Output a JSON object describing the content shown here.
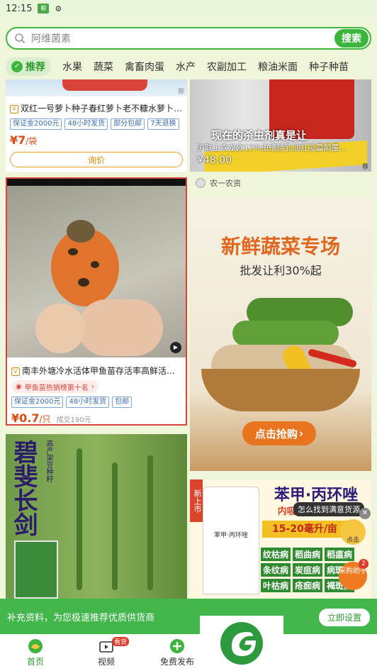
{
  "status": {
    "time": "12:15"
  },
  "search": {
    "placeholder": "阿维菌素",
    "button": "搜索"
  },
  "categories": {
    "active": "推荐",
    "items": [
      "水果",
      "蔬菜",
      "禽畜肉蛋",
      "水产",
      "农副加工",
      "粮油米面",
      "种子种苗"
    ]
  },
  "card1": {
    "title": "双红一号萝卜种子春红萝卜老不糠水萝卜种子",
    "tags": [
      "保证金2000元",
      "48小时发货",
      "部分包邮",
      "7天退换"
    ],
    "price": "¥7",
    "unit": "/袋",
    "inquire": "询价",
    "ad_corner": "荐"
  },
  "card2": {
    "overlay_title": "现在的杀虫剂真是让",
    "overlay_sub": "沪联上农龙欧12%虫螨腈乳油虹吸震颠覆...",
    "price": "¥48.00",
    "ad_corner": "荐",
    "seller": "农一农资"
  },
  "card3": {
    "title": "南丰外塘冷水活体甲鱼苗存活率高鲜活小甲鱼",
    "rank": "甲鱼苗热销榜第十名",
    "tags": [
      "保证金2000元",
      "48小时发货",
      "包邮"
    ],
    "price": "¥0.7",
    "unit": "/只",
    "sold": "成交190元"
  },
  "card4": {
    "headline": "新鲜蔬菜专场",
    "sub": "批发让利30%起",
    "cta": "点击抢购"
  },
  "card5": {
    "big_text": "碧斐长剑",
    "side_text": "高产架豆种籽"
  },
  "card6": {
    "label_new": "新上市",
    "headline": "苯甲·丙环唑",
    "sub": "内吸传导 杀菌治病",
    "dose": "15-20毫升/亩",
    "diseases": [
      "纹枯病",
      "稻曲病",
      "稻瘟病",
      "条纹病",
      "炭疽病",
      "病斑",
      "叶枯病",
      "疮痂病",
      "褐斑病"
    ]
  },
  "floating": {
    "tip": "怎么找到满意货源",
    "close": "✕",
    "face_label": "点击",
    "helper": "采购助手",
    "helper_badge": "2"
  },
  "banner": {
    "text": "补充资料，为您极速推荐优质供货商",
    "button": "立即设置"
  },
  "tabs": [
    {
      "label": "首页"
    },
    {
      "label": "视频",
      "badge": "看货"
    },
    {
      "label": "免费发布"
    }
  ]
}
